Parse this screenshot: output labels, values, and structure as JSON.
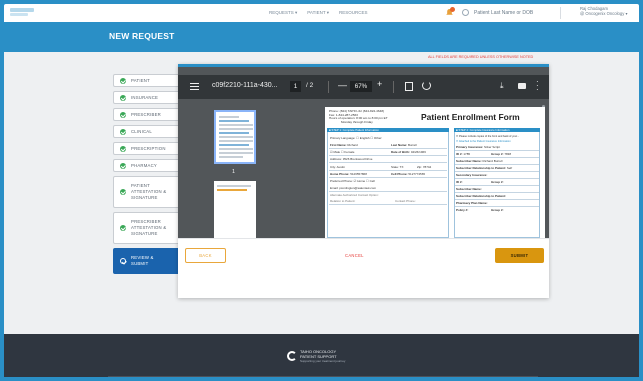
{
  "nav": {
    "requests": "REQUESTS ▾",
    "patient": "PATIENT ▾",
    "resources": "RESOURCES",
    "search_placeholder": "Patient Last Name or DOB",
    "user_name": "Raj Chodagam",
    "user_org": "@ Oncogenix Oncology ▾"
  },
  "page": {
    "title": "NEW REQUEST",
    "required_note": "ALL FIELDS ARE REQUIRED UNLESS OTHERWISE NOTED"
  },
  "steps": [
    {
      "label": "PATIENT",
      "complete": true
    },
    {
      "label": "INSURANCE",
      "complete": true
    },
    {
      "label": "PRESCRIBER",
      "complete": true
    },
    {
      "label": "CLINICAL",
      "complete": true
    },
    {
      "label": "PRESCRIPTION",
      "complete": true
    },
    {
      "label": "PHARMACY",
      "complete": true
    },
    {
      "label": "PATIENT ATTESTATION & SIGNATURE",
      "complete": true
    },
    {
      "label": "PRESCRIBER ATTESTATION & SIGNATURE",
      "complete": true
    },
    {
      "label": "REVIEW & SUBMIT",
      "complete": false,
      "active": true
    }
  ],
  "viewer": {
    "file_name": "c09f2210-111a-430...",
    "current_page": "1",
    "total_pages": "/ 2",
    "zoom": "67%",
    "thumb_label": "1"
  },
  "form": {
    "phone_lines": [
      "Phone: (844) TAIHO-4U (844-824-4648)",
      "Fax: 1-844-287-2563",
      "Hours of operation: 8:00 am to 8:00 pm ET",
      "Monday through Friday"
    ],
    "title": "Patient Enrollment Form",
    "step1": "■ STEP 1: Complete Patient Information",
    "step2": "■ STEP 2: Complete Insurance Information",
    "primary_language": "Primary Language: ☐ English ☐ Other:",
    "first_name_label": "First Name:",
    "first_name": "Richard",
    "last_name_label": "Last Name:",
    "last_name": "Burrell",
    "sex": "☑ Male ☐ Female",
    "dob_label": "Date of Birth:",
    "dob": "04/26/1966",
    "address_label": "Address:",
    "address": "3526 Brentwood Drive",
    "city_label": "City:",
    "city": "Austin",
    "state_label": "State:",
    "state": "TX",
    "zip_label": "Zip:",
    "zip": "78744",
    "home_phone_label": "Home Phone:",
    "home_phone": "5126557868",
    "cell_phone_label": "Cell Phone:",
    "cell_phone": "5127774565",
    "pref_phone": "Preferred Phone: ☑ Home ☐ Cell",
    "email_label": "Email:",
    "email": "pconlington@salemtek.com",
    "alt_contact": "Alternate Authorized Contact Option:",
    "relation": "Relation to Patient:",
    "contact_phone": "Contact Phone:",
    "ins_note": "☐ Please include copies of the front and back of your...",
    "ins_check": "☐ Attached is the Patient Insurance Information",
    "primary_ins_label": "Primary Insurance:",
    "primary_ins": "Silver Script",
    "id_label": "ID #:",
    "id": "1785",
    "group_label": "Group #:",
    "group": "7838",
    "subscriber_label": "Subscriber Name:",
    "subscriber": "Richard Burrell",
    "sub_rel_label": "Subscriber Relationship to Patient:",
    "sub_rel": "Self",
    "secondary_ins": "Secondary Insurance:",
    "id2": "ID #:",
    "group2": "Group #:",
    "sub2": "Subscriber Name:",
    "sub_rel2": "Subscriber Relationship to Patient:",
    "pharmacy_plan": "Pharmacy Plan Name:",
    "policy": "Policy #:",
    "group3": "Group #:"
  },
  "actions": {
    "back": "BACK",
    "cancel": "CANCEL",
    "submit": "SUBMIT"
  },
  "footer": {
    "brand_line1": "TAIHO ONCOLOGY",
    "brand_line2": "PATIENT SUPPORT",
    "tagline": "Supporting your treatment journey"
  },
  "colors": {
    "brand_blue": "#2a8fc6",
    "active_step": "#1a63ad",
    "submit": "#d9960f",
    "required_red": "#e53935",
    "check_green": "#3aa857"
  }
}
